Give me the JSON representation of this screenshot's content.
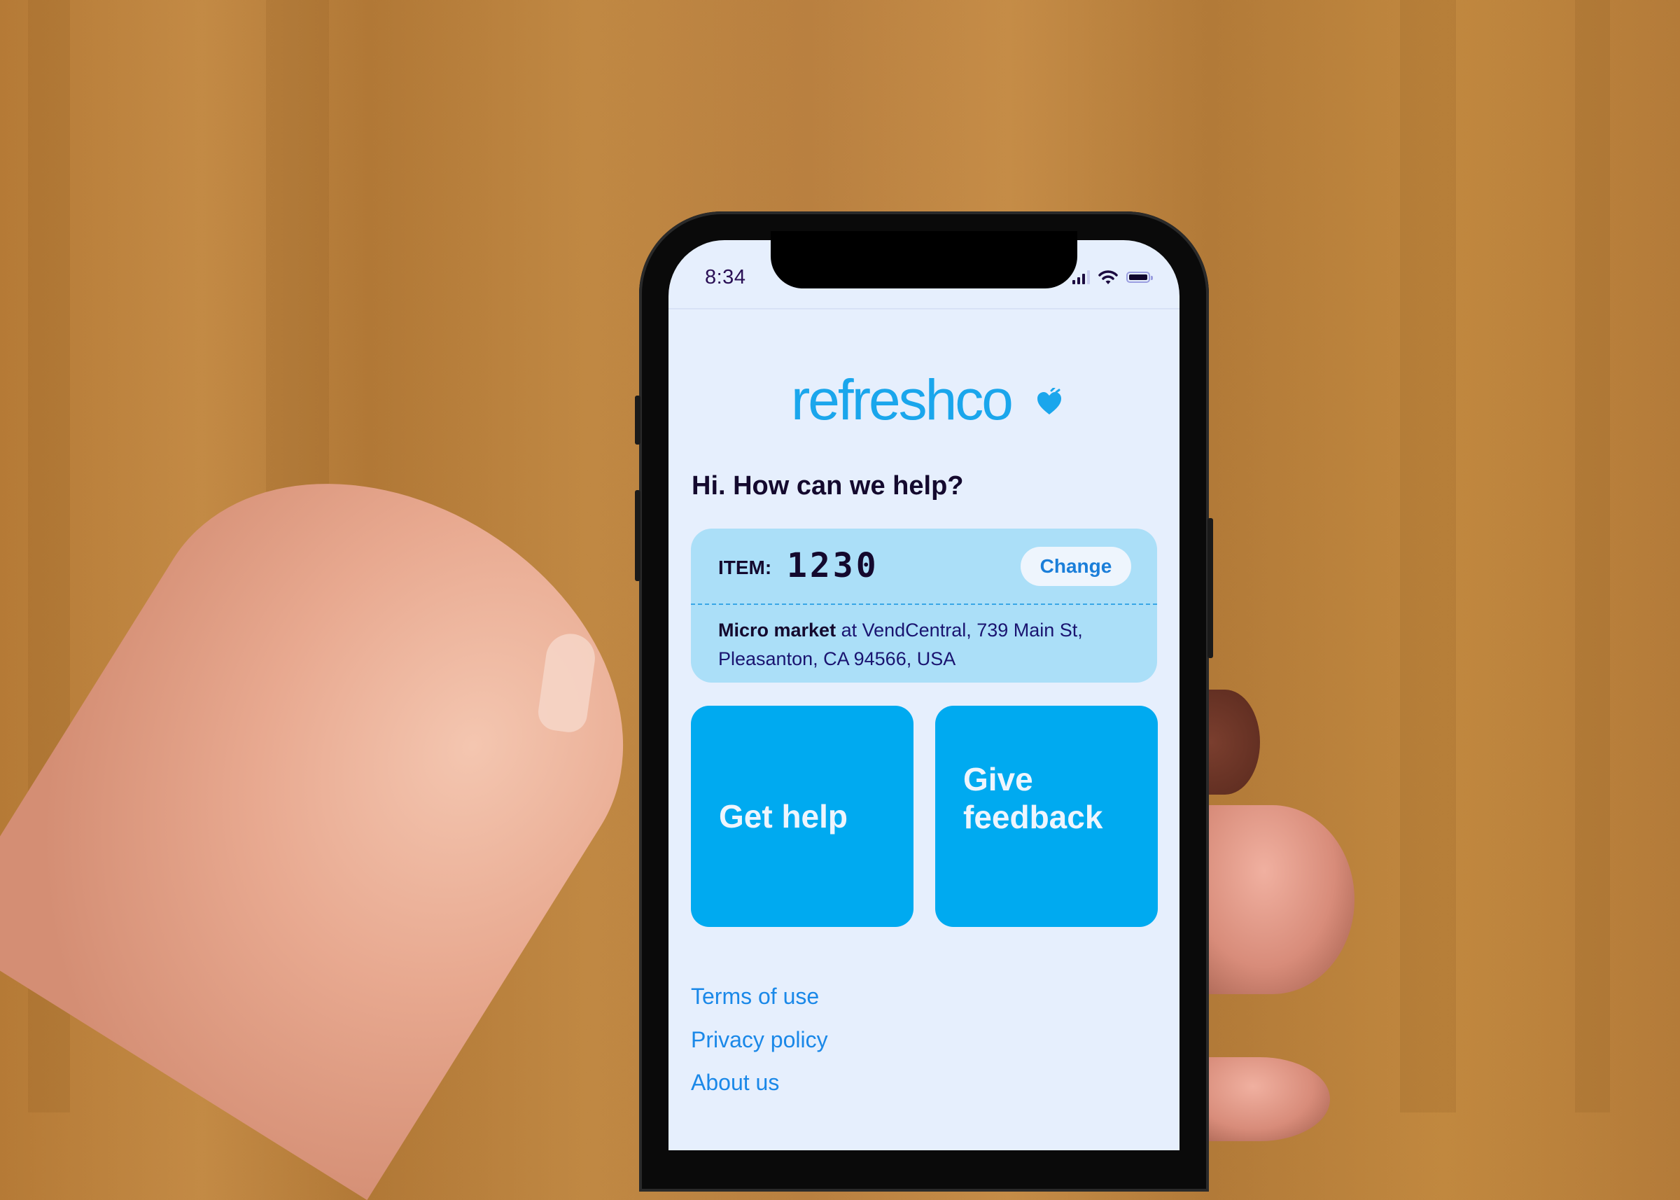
{
  "status_bar": {
    "time": "8:34",
    "icons": [
      "cellular-signal-icon",
      "wifi-icon",
      "battery-icon"
    ]
  },
  "app": {
    "brand": "refreshco",
    "brand_icon": "apple-heart-icon",
    "brand_color": "#1aa6ec",
    "greeting": "Hi. How can we help?"
  },
  "item_card": {
    "label": "ITEM:",
    "number": "1230",
    "change_label": "Change",
    "location_type": "Micro market",
    "location_text": " at VendCentral, 739 Main St, Pleasanton, CA 94566, USA",
    "background": "#abdff8"
  },
  "actions": [
    {
      "label": "Get help"
    },
    {
      "label": "Give feedback"
    }
  ],
  "action_color": "#00aaf0",
  "footer_links": [
    {
      "label": "Terms of use"
    },
    {
      "label": "Privacy policy"
    },
    {
      "label": "About us"
    }
  ]
}
